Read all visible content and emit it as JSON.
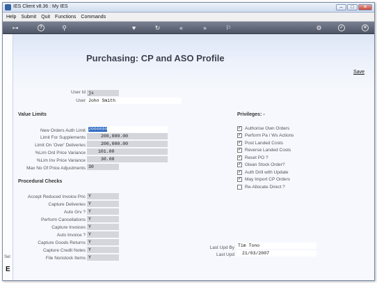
{
  "window": {
    "title": "IES Client v8.36 : My IES",
    "min": "–",
    "max": "□",
    "close": "✕"
  },
  "menu": [
    "Help",
    "Submit",
    "Quit",
    "Functions",
    "Commands"
  ],
  "toolbar": {
    "key": "⊶",
    "help": "?",
    "search": "⚲",
    "heart": "♥",
    "refresh": "↻",
    "back": "«",
    "forward": "»",
    "flag": "⚐",
    "settings": "⚙",
    "ok": "✓",
    "cancel": "✕"
  },
  "page": {
    "title": "Purchasing: CP and ASO Profile",
    "save": "Save"
  },
  "user": {
    "id_label": "User Id",
    "id": "js",
    "user_label": "User",
    "name": "John Smith"
  },
  "value_limits": {
    "heading": "Value Limits",
    "rows": [
      {
        "label": "New Orders Auth Limit",
        "value": "2000000"
      },
      {
        "label": "Limit For Supplements",
        "value": "200,000.00"
      },
      {
        "label": "Limit On 'Over' Deliveries",
        "value": "200,000.00"
      },
      {
        "label": "%Lim Ord Price Variance",
        "value": "101.00"
      },
      {
        "label": "%Lim Inv Price Variance",
        "value": "30.00"
      },
      {
        "label": "Max No Of Price Adjustments",
        "value": "30"
      }
    ]
  },
  "procedural": {
    "heading": "Procedural Checks",
    "rows": [
      {
        "label": "Accept Reduced Invoice Pric",
        "value": "Y"
      },
      {
        "label": "Capture Deliveries",
        "value": "Y"
      },
      {
        "label": "Auto Grv ?",
        "value": "Y"
      },
      {
        "label": "Perform Cancellations",
        "value": "Y"
      },
      {
        "label": "Capture Invoices",
        "value": "Y"
      },
      {
        "label": "Auto Invoice ?",
        "value": "Y"
      },
      {
        "label": "Capture Goods Returns",
        "value": "Y"
      },
      {
        "label": "Capture Credit Notes",
        "value": "Y"
      },
      {
        "label": "File Nonstock Items",
        "value": "Y"
      }
    ]
  },
  "privileges": {
    "heading": "Privileges: -",
    "items": [
      {
        "label": "Authorise Own Orders",
        "checked": true,
        "mark": "✓"
      },
      {
        "label": "Perform Pa / Ws Actions",
        "checked": true,
        "mark": "✓"
      },
      {
        "label": "Post Landed Costs",
        "checked": true,
        "mark": "✓"
      },
      {
        "label": "Reverse Landed Costs",
        "checked": true,
        "mark": "✓"
      },
      {
        "label": "Reset PO ?",
        "checked": true,
        "mark": "✓"
      },
      {
        "label": "Glean Stock Order?",
        "checked": true,
        "mark": "✓"
      },
      {
        "label": "Auth Drill with Update",
        "checked": true,
        "mark": "✓"
      },
      {
        "label": "May Import CP Orders",
        "checked": true,
        "mark": "✓"
      },
      {
        "label": "Re-Allocate Direct ?",
        "checked": false,
        "mark": ""
      }
    ]
  },
  "audit": {
    "upd_by_label": "Last Upd By",
    "upd_by": "Tim Tono",
    "upd_label": "Last Upd",
    "upd": "21/03/2007"
  },
  "sidebar": {
    "sel": "Sel",
    "icon": "E"
  }
}
